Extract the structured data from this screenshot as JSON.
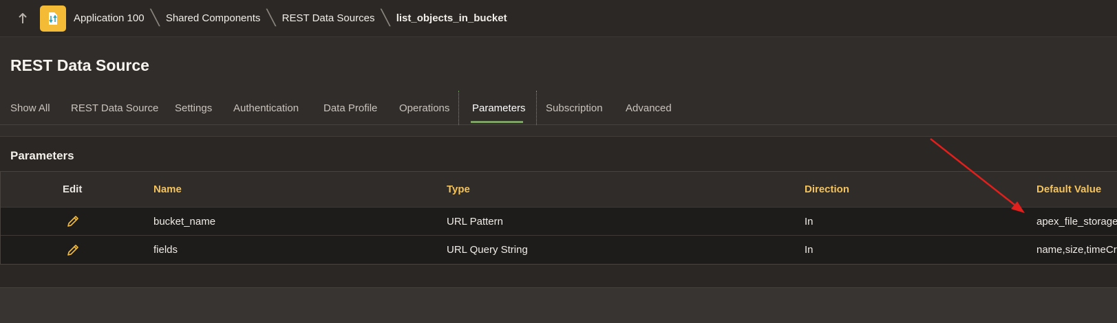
{
  "breadcrumb": {
    "items": [
      "Application 100",
      "Shared Components",
      "REST Data Sources"
    ],
    "current": "list_objects_in_bucket"
  },
  "page": {
    "title": "REST Data Source"
  },
  "tabs": [
    {
      "label": "Show All"
    },
    {
      "label": "REST Data Source"
    },
    {
      "label": "Settings"
    },
    {
      "label": "Authentication"
    },
    {
      "label": "Data Profile"
    },
    {
      "label": "Operations"
    },
    {
      "label": "Parameters",
      "active": true
    },
    {
      "label": "Subscription"
    },
    {
      "label": "Advanced"
    }
  ],
  "region": {
    "title": "Parameters",
    "columns": {
      "edit": "Edit",
      "name": "Name",
      "type": "Type",
      "direction": "Direction",
      "default": "Default Value"
    },
    "rows": [
      {
        "name": "bucket_name",
        "type": "URL Pattern",
        "direction": "In",
        "default": "apex_file_storage"
      },
      {
        "name": "fields",
        "type": "URL Query String",
        "direction": "In",
        "default": "name,size,timeCre"
      }
    ]
  },
  "colors": {
    "accent_tab": "#7fa266",
    "header_text": "#f5c35b",
    "annotation_arrow": "#e0201d",
    "app_icon_bg": "#f4bb37"
  },
  "icons": {
    "up": "arrow-up-icon",
    "app": "app-sync-icon",
    "edit": "pencil-icon"
  }
}
